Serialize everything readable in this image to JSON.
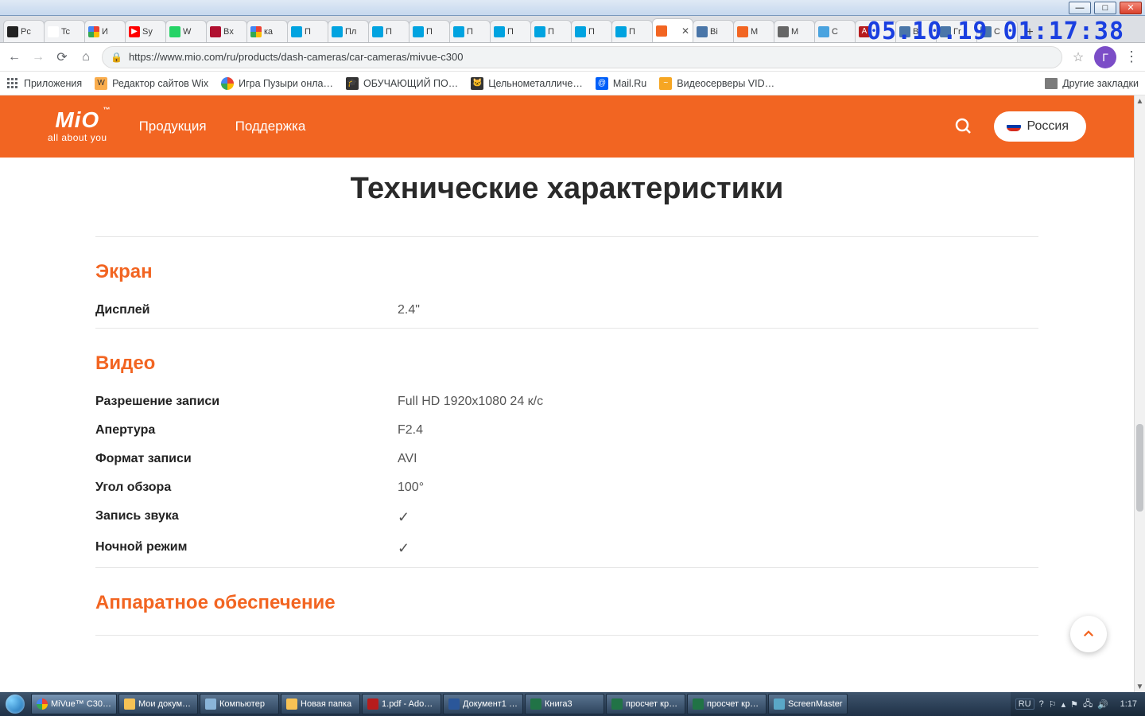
{
  "overlay_timestamp": "05.10.19 01:17:38",
  "window_buttons": {
    "min": "—",
    "max": "□",
    "close": "✕"
  },
  "tabs": [
    {
      "label": "Pc",
      "color": "#222"
    },
    {
      "label": "Tc",
      "color": "#fff",
      "text": "#555"
    },
    {
      "label": "И",
      "color": "#fff",
      "g": true
    },
    {
      "label": "Sy",
      "color": "#f00",
      "yt": true
    },
    {
      "label": "W",
      "color": "#25d366"
    },
    {
      "label": "Bx",
      "color": "#b01030"
    },
    {
      "label": "кa",
      "color": "#fff",
      "g": true
    },
    {
      "label": "П",
      "color": "#00a3e0"
    },
    {
      "label": "Пл",
      "color": "#00a3e0"
    },
    {
      "label": "П",
      "color": "#00a3e0"
    },
    {
      "label": "П",
      "color": "#00a3e0"
    },
    {
      "label": "П",
      "color": "#00a3e0"
    },
    {
      "label": "П",
      "color": "#00a3e0"
    },
    {
      "label": "П",
      "color": "#00a3e0"
    },
    {
      "label": "П",
      "color": "#00a3e0"
    },
    {
      "label": "П",
      "color": "#00a3e0"
    },
    {
      "label": "",
      "color": "#f26522",
      "active": true,
      "closable": true
    },
    {
      "label": "Bi",
      "color": "#4a76a8"
    },
    {
      "label": "M",
      "color": "#f26522"
    },
    {
      "label": "M",
      "color": "#666"
    },
    {
      "label": "C",
      "color": "#4aa3df"
    },
    {
      "label": "",
      "color": "#b71c1c",
      "pdf": true
    },
    {
      "label": "Bi",
      "color": "#4a76a8"
    },
    {
      "label": "Гr",
      "color": "#4a76a8"
    },
    {
      "label": "C",
      "color": "#4a76a8"
    }
  ],
  "toolbar": {
    "url": "https://www.mio.com/ru/products/dash-cameras/car-cameras/mivue-c300",
    "profile_letter": "Г"
  },
  "bookmarks": [
    {
      "label": "Приложения",
      "icon": "apps",
      "color": "#666"
    },
    {
      "label": "Редактор сайтов Wix",
      "icon": "W",
      "color": "#faad4d"
    },
    {
      "label": "Игра Пузыри онла…",
      "icon": "G",
      "color": "#fff",
      "g": true
    },
    {
      "label": "ОБУЧАЮЩИЙ ПО…",
      "icon": "🎓",
      "color": "#333"
    },
    {
      "label": "Цельнометалличе…",
      "icon": "🐱",
      "color": "#333"
    },
    {
      "label": "Mail.Ru",
      "icon": "@",
      "color": "#005ff9"
    },
    {
      "label": "Видеосерверы VID…",
      "icon": "~",
      "color": "#f6a623"
    }
  ],
  "bookmarks_other": "Другие закладки",
  "header": {
    "logo_tm": "™",
    "tagline": "all about you",
    "nav": [
      "Продукция",
      "Поддержка"
    ],
    "country": "Россия"
  },
  "page": {
    "title": "Технические характеристики",
    "sections": [
      {
        "title": "Экран",
        "rows": [
          {
            "k": "Дисплей",
            "v": "2.4\""
          }
        ]
      },
      {
        "title": "Видео",
        "rows": [
          {
            "k": "Разрешение записи",
            "v": "Full HD 1920x1080 24 к/с"
          },
          {
            "k": "Апертура",
            "v": "F2.4"
          },
          {
            "k": "Формат записи",
            "v": "AVI"
          },
          {
            "k": "Угол обзора",
            "v": "100°"
          },
          {
            "k": "Запись звука",
            "v": "✓",
            "check": true
          },
          {
            "k": "Ночной режим",
            "v": "✓",
            "check": true
          }
        ]
      },
      {
        "title": "Аппаратное обеспечение",
        "partial": true
      }
    ]
  },
  "taskbar": {
    "items": [
      {
        "label": "MiVue™ C30…",
        "color": "#fff",
        "chrome": true,
        "active": true
      },
      {
        "label": "Мои докум…",
        "color": "#f7c255"
      },
      {
        "label": "Компьютер",
        "color": "#8ab4d8"
      },
      {
        "label": "Новая папка",
        "color": "#f7c255"
      },
      {
        "label": "1.pdf - Ado…",
        "color": "#b71c1c"
      },
      {
        "label": "Документ1 …",
        "color": "#2b579a"
      },
      {
        "label": "Книга3",
        "color": "#217346"
      },
      {
        "label": "просчет кр…",
        "color": "#217346"
      },
      {
        "label": "просчет кр…",
        "color": "#217346"
      },
      {
        "label": "ScreenMaster",
        "color": "#5aa7c7"
      }
    ],
    "lang": "RU",
    "clock": "1:17"
  }
}
